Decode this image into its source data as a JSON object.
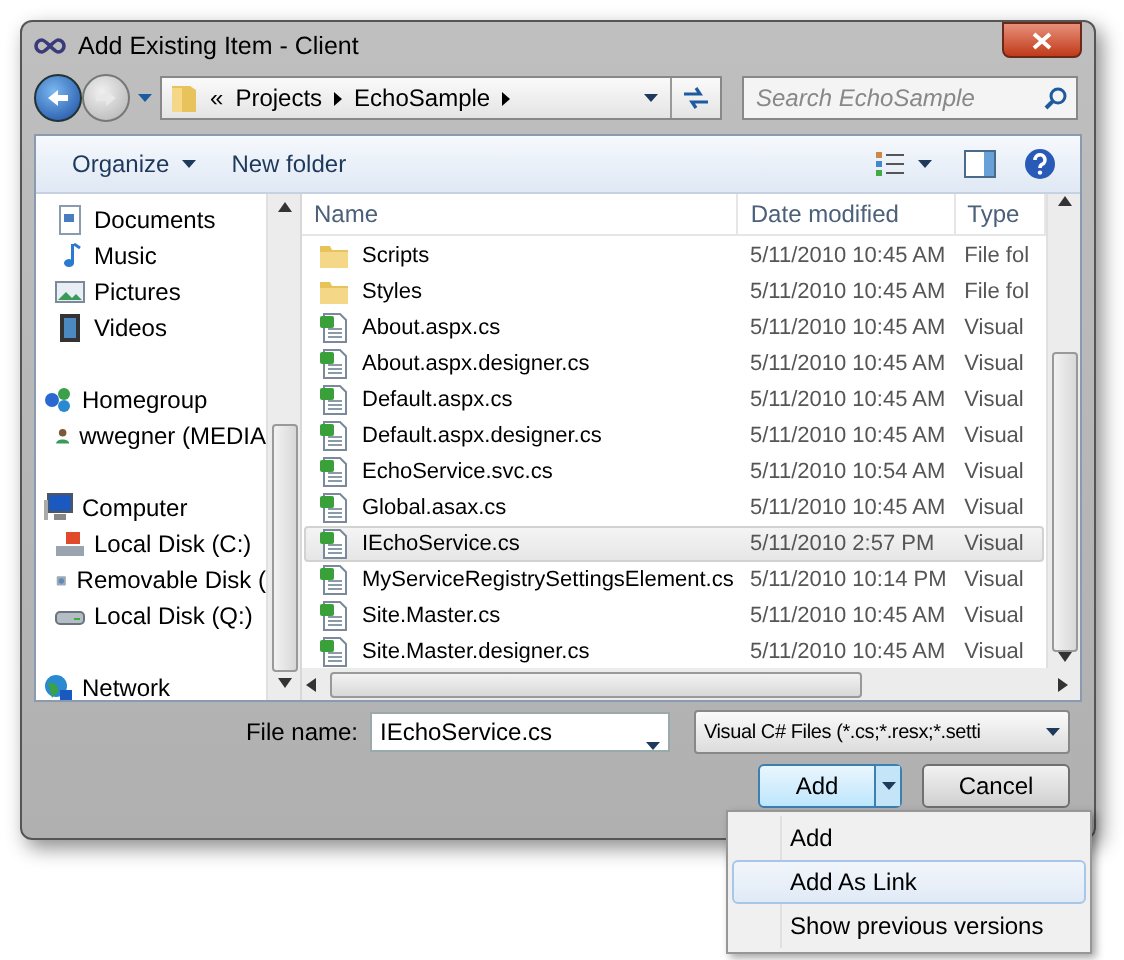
{
  "window": {
    "title": "Add Existing Item - Client"
  },
  "address": {
    "overflow": "«",
    "crumbs": [
      "Projects",
      "EchoSample"
    ]
  },
  "search": {
    "placeholder": "Search EchoSample"
  },
  "toolbar": {
    "organize": "Organize",
    "new_folder": "New folder"
  },
  "sidebar": {
    "partial_group": [
      {
        "label": "Documents",
        "kind": "documents"
      },
      {
        "label": "Music",
        "kind": "music"
      },
      {
        "label": "Pictures",
        "kind": "pictures"
      },
      {
        "label": "Videos",
        "kind": "videos"
      }
    ],
    "items": [
      {
        "label": "Homegroup",
        "kind": "homegroup",
        "children": [
          {
            "label": "wwegner (MEDIA",
            "kind": "user"
          }
        ]
      },
      {
        "label": "Computer",
        "kind": "computer",
        "children": [
          {
            "label": "Local Disk (C:)",
            "kind": "disk"
          },
          {
            "label": "Removable Disk (",
            "kind": "removable"
          },
          {
            "label": "Local Disk (Q:)",
            "kind": "drive"
          }
        ]
      },
      {
        "label": "Network",
        "kind": "network"
      }
    ]
  },
  "table": {
    "columns": [
      "Name",
      "Date modified",
      "Type"
    ],
    "rows": [
      {
        "name": "Scripts",
        "date": "5/11/2010 10:45 AM",
        "type": "File fol",
        "kind": "folder",
        "selected": false
      },
      {
        "name": "Styles",
        "date": "5/11/2010 10:45 AM",
        "type": "File fol",
        "kind": "folder",
        "selected": false
      },
      {
        "name": "About.aspx.cs",
        "date": "5/11/2010 10:45 AM",
        "type": "Visual",
        "kind": "cs",
        "selected": false
      },
      {
        "name": "About.aspx.designer.cs",
        "date": "5/11/2010 10:45 AM",
        "type": "Visual",
        "kind": "cs",
        "selected": false
      },
      {
        "name": "Default.aspx.cs",
        "date": "5/11/2010 10:45 AM",
        "type": "Visual",
        "kind": "cs",
        "selected": false
      },
      {
        "name": "Default.aspx.designer.cs",
        "date": "5/11/2010 10:45 AM",
        "type": "Visual",
        "kind": "cs",
        "selected": false
      },
      {
        "name": "EchoService.svc.cs",
        "date": "5/11/2010 10:54 AM",
        "type": "Visual",
        "kind": "cs",
        "selected": false
      },
      {
        "name": "Global.asax.cs",
        "date": "5/11/2010 10:45 AM",
        "type": "Visual",
        "kind": "cs",
        "selected": false
      },
      {
        "name": "IEchoService.cs",
        "date": "5/11/2010 2:57 PM",
        "type": "Visual",
        "kind": "cs",
        "selected": true
      },
      {
        "name": "MyServiceRegistrySettingsElement.cs",
        "date": "5/11/2010 10:14 PM",
        "type": "Visual",
        "kind": "cs",
        "selected": false
      },
      {
        "name": "Site.Master.cs",
        "date": "5/11/2010 10:45 AM",
        "type": "Visual",
        "kind": "cs",
        "selected": false
      },
      {
        "name": "Site.Master.designer.cs",
        "date": "5/11/2010 10:45 AM",
        "type": "Visual",
        "kind": "cs",
        "selected": false
      }
    ]
  },
  "file_name": {
    "label": "File name:",
    "value": "IEchoService.cs"
  },
  "file_type": {
    "value": "Visual C# Files (*.cs;*.resx;*.setti"
  },
  "buttons": {
    "add": "Add",
    "cancel": "Cancel"
  },
  "menu": [
    {
      "label": "Add",
      "selected": false
    },
    {
      "label": "Add As Link",
      "selected": true
    },
    {
      "label": "Show previous versions",
      "selected": false
    }
  ]
}
